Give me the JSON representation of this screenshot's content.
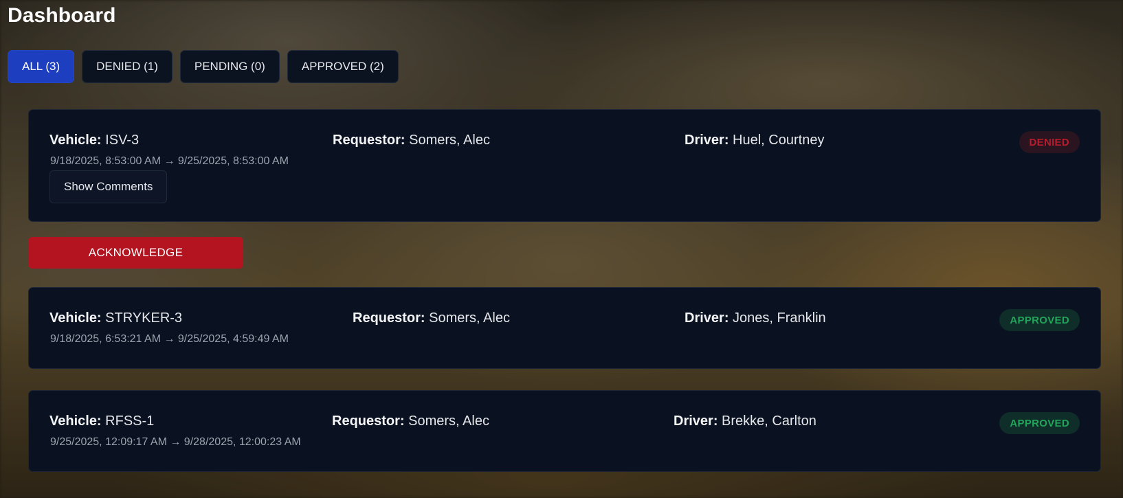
{
  "header": {
    "title": "Dashboard"
  },
  "filters": [
    {
      "label": "ALL (3)",
      "active": true
    },
    {
      "label": "DENIED (1)",
      "active": false
    },
    {
      "label": "PENDING (0)",
      "active": false
    },
    {
      "label": "APPROVED (2)",
      "active": false
    }
  ],
  "labels": {
    "vehicle": "Vehicle:",
    "requestor": "Requestor:",
    "driver": "Driver:"
  },
  "requests": [
    {
      "vehicle": "ISV-3",
      "requestor": "Somers, Alec",
      "driver": "Huel, Courtney",
      "dates": "9/18/2025, 8:53:00 AM → 9/25/2025, 8:53:00 AM",
      "status": "DENIED",
      "comments_label": "Show Comments"
    },
    {
      "vehicle": "STRYKER-3",
      "requestor": "Somers, Alec",
      "driver": "Jones, Franklin",
      "dates": "9/18/2025, 6:53:21 AM → 9/25/2025, 4:59:49 AM",
      "status": "APPROVED"
    },
    {
      "vehicle": "RFSS-1",
      "requestor": "Somers, Alec",
      "driver": "Brekke, Carlton",
      "dates": "9/25/2025, 12:09:17 AM → 9/28/2025, 12:00:23 AM",
      "status": "APPROVED"
    }
  ],
  "acknowledge_label": "ACKNOWLEDGE",
  "colors": {
    "accent": "#1d3fbf",
    "card_bg": "#0a1120",
    "denied": "#b91c2c",
    "approved": "#22a55a",
    "acknowledge": "#b3141f"
  }
}
